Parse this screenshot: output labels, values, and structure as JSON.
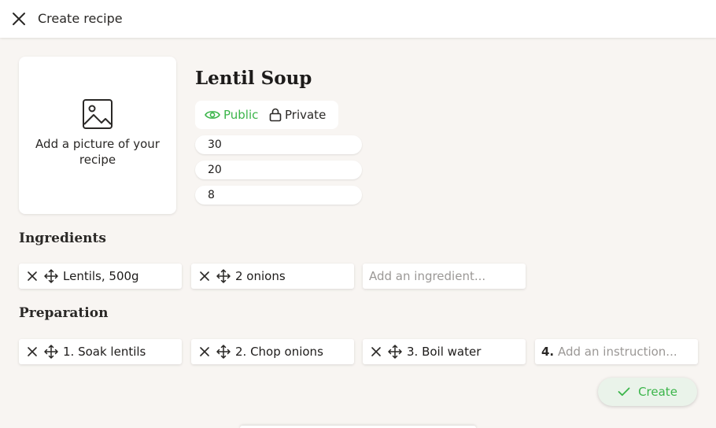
{
  "header": {
    "title": "Create recipe",
    "close_icon": "close-icon"
  },
  "picture": {
    "icon": "image-icon",
    "label": "Add a picture of your recipe"
  },
  "recipe": {
    "title": "Lentil Soup",
    "visibility": {
      "public_label": "Public",
      "private_label": "Private",
      "selected": "Public"
    },
    "fields": [
      "30",
      "20",
      "8"
    ]
  },
  "ingredients": {
    "heading": "Ingredients",
    "items": [
      "Lentils, 500g",
      "2 onions"
    ],
    "placeholder": "Add an ingredient..."
  },
  "preparation": {
    "heading": "Preparation",
    "steps": [
      "1. Soak lentils",
      "2. Chop onions",
      "3. Boil water"
    ],
    "next_number": "4.",
    "placeholder": "Add an instruction..."
  },
  "actions": {
    "create_label": "Create"
  },
  "colors": {
    "accent": "#3bb54a",
    "background": "#f8f5f2",
    "surface": "#ffffff"
  }
}
